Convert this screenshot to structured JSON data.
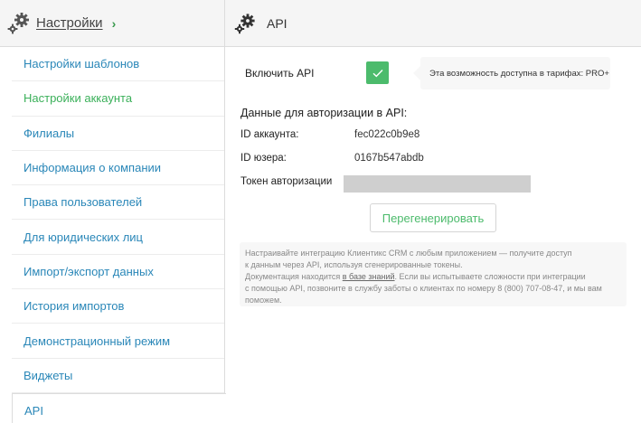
{
  "sidebar": {
    "title": "Настройки",
    "chevron": "›",
    "items": [
      {
        "label": "Настройки шаблонов"
      },
      {
        "label": "Настройки аккаунта"
      },
      {
        "label": "Филиалы"
      },
      {
        "label": "Информация о компании"
      },
      {
        "label": "Права пользователей"
      },
      {
        "label": "Для юридических лиц"
      },
      {
        "label": "Импорт/экспорт данных"
      },
      {
        "label": "История импортов"
      },
      {
        "label": "Демонстрационный режим"
      },
      {
        "label": "Виджеты"
      },
      {
        "label": "API"
      }
    ]
  },
  "main": {
    "title": "API",
    "enable_label": "Включить API",
    "enable_checked": true,
    "tariff_note": "Эта возможность доступна в тарифах: PRO+",
    "auth_heading": "Данные для авторизации в API:",
    "account_id_label": "ID аккаунта:",
    "account_id_value": "fec022c0b9e8",
    "user_id_label": "ID юзера:",
    "user_id_value": "0167b547abdb",
    "token_label": "Токен авторизации",
    "regen_button": "Перегенерировать",
    "info_line1": "Настраивайте интеграцию Клиентикс CRM с любым приложением — получите доступ",
    "info_line2": "к данным через API, используя сгенерированные токены.",
    "info_line3_a": "Документация находится ",
    "info_link": "в базе знаний",
    "info_line3_b": ". Если вы испытываете сложности при интеграции",
    "info_line4": "с помощью API, позвоните в службу заботы о клиентах по номеру 8 (800) 707-08-47, и мы вам",
    "info_line5": "поможем."
  },
  "colors": {
    "accent_green": "#4cbb6c",
    "link_blue": "#2a87b8",
    "active_item_green": "#3bb05a"
  },
  "icons": {
    "header": "gears-icon",
    "checkbox": "check-icon"
  }
}
